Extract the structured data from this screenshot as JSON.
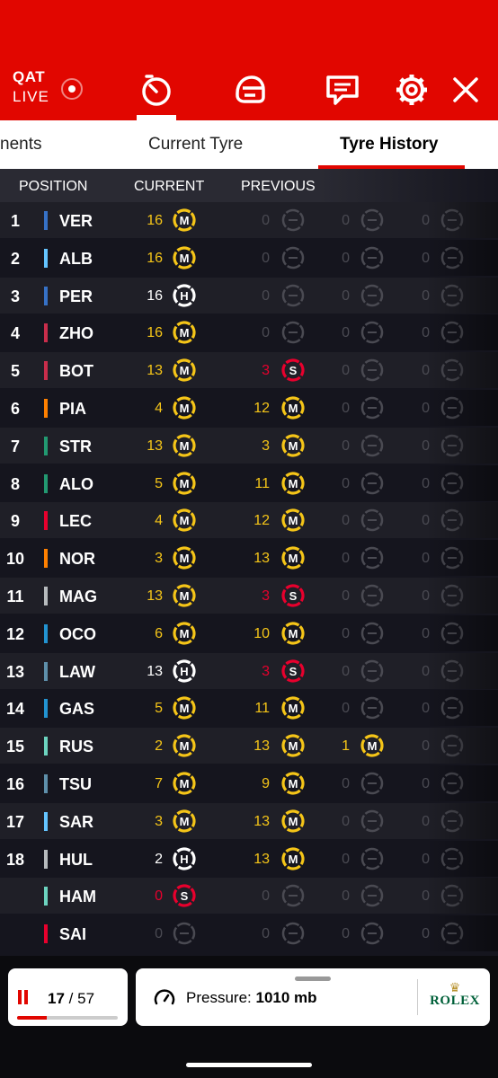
{
  "header": {
    "circuit_code": "QAT",
    "live_label": "LIVE",
    "icons": [
      "timer-icon",
      "helmet-icon",
      "race-control-icon",
      "settings-icon",
      "close-icon"
    ]
  },
  "tabs": [
    {
      "label": "nents"
    },
    {
      "label": "Current Tyre"
    },
    {
      "label": "Tyre History",
      "active": true
    }
  ],
  "table": {
    "columns": {
      "position": "POSITION",
      "current": "CURRENT",
      "previous": "PREVIOUS"
    },
    "rows": [
      {
        "pos": "1",
        "driver": "VER",
        "team_color": "#3671c6",
        "stints": [
          {
            "laps": 16,
            "c": "M"
          },
          {
            "laps": 0,
            "c": "-"
          },
          {
            "laps": 0,
            "c": "-"
          },
          {
            "laps": 0,
            "c": "-"
          }
        ]
      },
      {
        "pos": "2",
        "driver": "ALB",
        "team_color": "#64c4ff",
        "stints": [
          {
            "laps": 16,
            "c": "M"
          },
          {
            "laps": 0,
            "c": "-"
          },
          {
            "laps": 0,
            "c": "-"
          },
          {
            "laps": 0,
            "c": "-"
          }
        ]
      },
      {
        "pos": "3",
        "driver": "PER",
        "team_color": "#3671c6",
        "stints": [
          {
            "laps": 16,
            "c": "H"
          },
          {
            "laps": 0,
            "c": "-"
          },
          {
            "laps": 0,
            "c": "-"
          },
          {
            "laps": 0,
            "c": "-"
          }
        ]
      },
      {
        "pos": "4",
        "driver": "ZHO",
        "team_color": "#c92d4b",
        "stints": [
          {
            "laps": 16,
            "c": "M"
          },
          {
            "laps": 0,
            "c": "-"
          },
          {
            "laps": 0,
            "c": "-"
          },
          {
            "laps": 0,
            "c": "-"
          }
        ]
      },
      {
        "pos": "5",
        "driver": "BOT",
        "team_color": "#c92d4b",
        "stints": [
          {
            "laps": 13,
            "c": "M"
          },
          {
            "laps": 3,
            "c": "S"
          },
          {
            "laps": 0,
            "c": "-"
          },
          {
            "laps": 0,
            "c": "-"
          }
        ]
      },
      {
        "pos": "6",
        "driver": "PIA",
        "team_color": "#ff8000",
        "stints": [
          {
            "laps": 4,
            "c": "M"
          },
          {
            "laps": 12,
            "c": "M"
          },
          {
            "laps": 0,
            "c": "-"
          },
          {
            "laps": 0,
            "c": "-"
          }
        ]
      },
      {
        "pos": "7",
        "driver": "STR",
        "team_color": "#229971",
        "stints": [
          {
            "laps": 13,
            "c": "M"
          },
          {
            "laps": 3,
            "c": "M"
          },
          {
            "laps": 0,
            "c": "-"
          },
          {
            "laps": 0,
            "c": "-"
          }
        ]
      },
      {
        "pos": "8",
        "driver": "ALO",
        "team_color": "#229971",
        "stints": [
          {
            "laps": 5,
            "c": "M"
          },
          {
            "laps": 11,
            "c": "M"
          },
          {
            "laps": 0,
            "c": "-"
          },
          {
            "laps": 0,
            "c": "-"
          }
        ]
      },
      {
        "pos": "9",
        "driver": "LEC",
        "team_color": "#e8002d",
        "stints": [
          {
            "laps": 4,
            "c": "M"
          },
          {
            "laps": 12,
            "c": "M"
          },
          {
            "laps": 0,
            "c": "-"
          },
          {
            "laps": 0,
            "c": "-"
          }
        ]
      },
      {
        "pos": "10",
        "driver": "NOR",
        "team_color": "#ff8000",
        "stints": [
          {
            "laps": 3,
            "c": "M"
          },
          {
            "laps": 13,
            "c": "M"
          },
          {
            "laps": 0,
            "c": "-"
          },
          {
            "laps": 0,
            "c": "-"
          }
        ]
      },
      {
        "pos": "11",
        "driver": "MAG",
        "team_color": "#b6babd",
        "stints": [
          {
            "laps": 13,
            "c": "M"
          },
          {
            "laps": 3,
            "c": "S"
          },
          {
            "laps": 0,
            "c": "-"
          },
          {
            "laps": 0,
            "c": "-"
          }
        ]
      },
      {
        "pos": "12",
        "driver": "OCO",
        "team_color": "#2293d1",
        "stints": [
          {
            "laps": 6,
            "c": "M"
          },
          {
            "laps": 10,
            "c": "M"
          },
          {
            "laps": 0,
            "c": "-"
          },
          {
            "laps": 0,
            "c": "-"
          }
        ]
      },
      {
        "pos": "13",
        "driver": "LAW",
        "team_color": "#5e8faa",
        "stints": [
          {
            "laps": 13,
            "c": "H"
          },
          {
            "laps": 3,
            "c": "S"
          },
          {
            "laps": 0,
            "c": "-"
          },
          {
            "laps": 0,
            "c": "-"
          }
        ]
      },
      {
        "pos": "14",
        "driver": "GAS",
        "team_color": "#2293d1",
        "stints": [
          {
            "laps": 5,
            "c": "M"
          },
          {
            "laps": 11,
            "c": "M"
          },
          {
            "laps": 0,
            "c": "-"
          },
          {
            "laps": 0,
            "c": "-"
          }
        ]
      },
      {
        "pos": "15",
        "driver": "RUS",
        "team_color": "#6cd3bf",
        "stints": [
          {
            "laps": 2,
            "c": "M"
          },
          {
            "laps": 13,
            "c": "M"
          },
          {
            "laps": 1,
            "c": "M"
          },
          {
            "laps": 0,
            "c": "-"
          }
        ]
      },
      {
        "pos": "16",
        "driver": "TSU",
        "team_color": "#5e8faa",
        "stints": [
          {
            "laps": 7,
            "c": "M"
          },
          {
            "laps": 9,
            "c": "M"
          },
          {
            "laps": 0,
            "c": "-"
          },
          {
            "laps": 0,
            "c": "-"
          }
        ]
      },
      {
        "pos": "17",
        "driver": "SAR",
        "team_color": "#64c4ff",
        "stints": [
          {
            "laps": 3,
            "c": "M"
          },
          {
            "laps": 13,
            "c": "M"
          },
          {
            "laps": 0,
            "c": "-"
          },
          {
            "laps": 0,
            "c": "-"
          }
        ]
      },
      {
        "pos": "18",
        "driver": "HUL",
        "team_color": "#b6babd",
        "stints": [
          {
            "laps": 2,
            "c": "H"
          },
          {
            "laps": 13,
            "c": "M"
          },
          {
            "laps": 0,
            "c": "-"
          },
          {
            "laps": 0,
            "c": "-"
          }
        ]
      },
      {
        "pos": "",
        "driver": "HAM",
        "team_color": "#6cd3bf",
        "stints": [
          {
            "laps": 0,
            "c": "S"
          },
          {
            "laps": 0,
            "c": "-"
          },
          {
            "laps": 0,
            "c": "-"
          },
          {
            "laps": 0,
            "c": "-"
          }
        ]
      },
      {
        "pos": "",
        "driver": "SAI",
        "team_color": "#e8002d",
        "stints": [
          {
            "laps": 0,
            "c": "-"
          },
          {
            "laps": 0,
            "c": "-"
          },
          {
            "laps": 0,
            "c": "-"
          },
          {
            "laps": 0,
            "c": "-"
          }
        ]
      }
    ]
  },
  "compound_colors": {
    "M": "#f5c518",
    "H": "#ffffff",
    "S": "#e8002d",
    "-": "#4a4a52"
  },
  "lap_counter": {
    "current": "17",
    "separator": "/",
    "total": "57",
    "progress": 0.298
  },
  "weather": {
    "label": "Pressure:",
    "value": "1010 mb"
  },
  "sponsor": {
    "name": "ROLEX"
  }
}
